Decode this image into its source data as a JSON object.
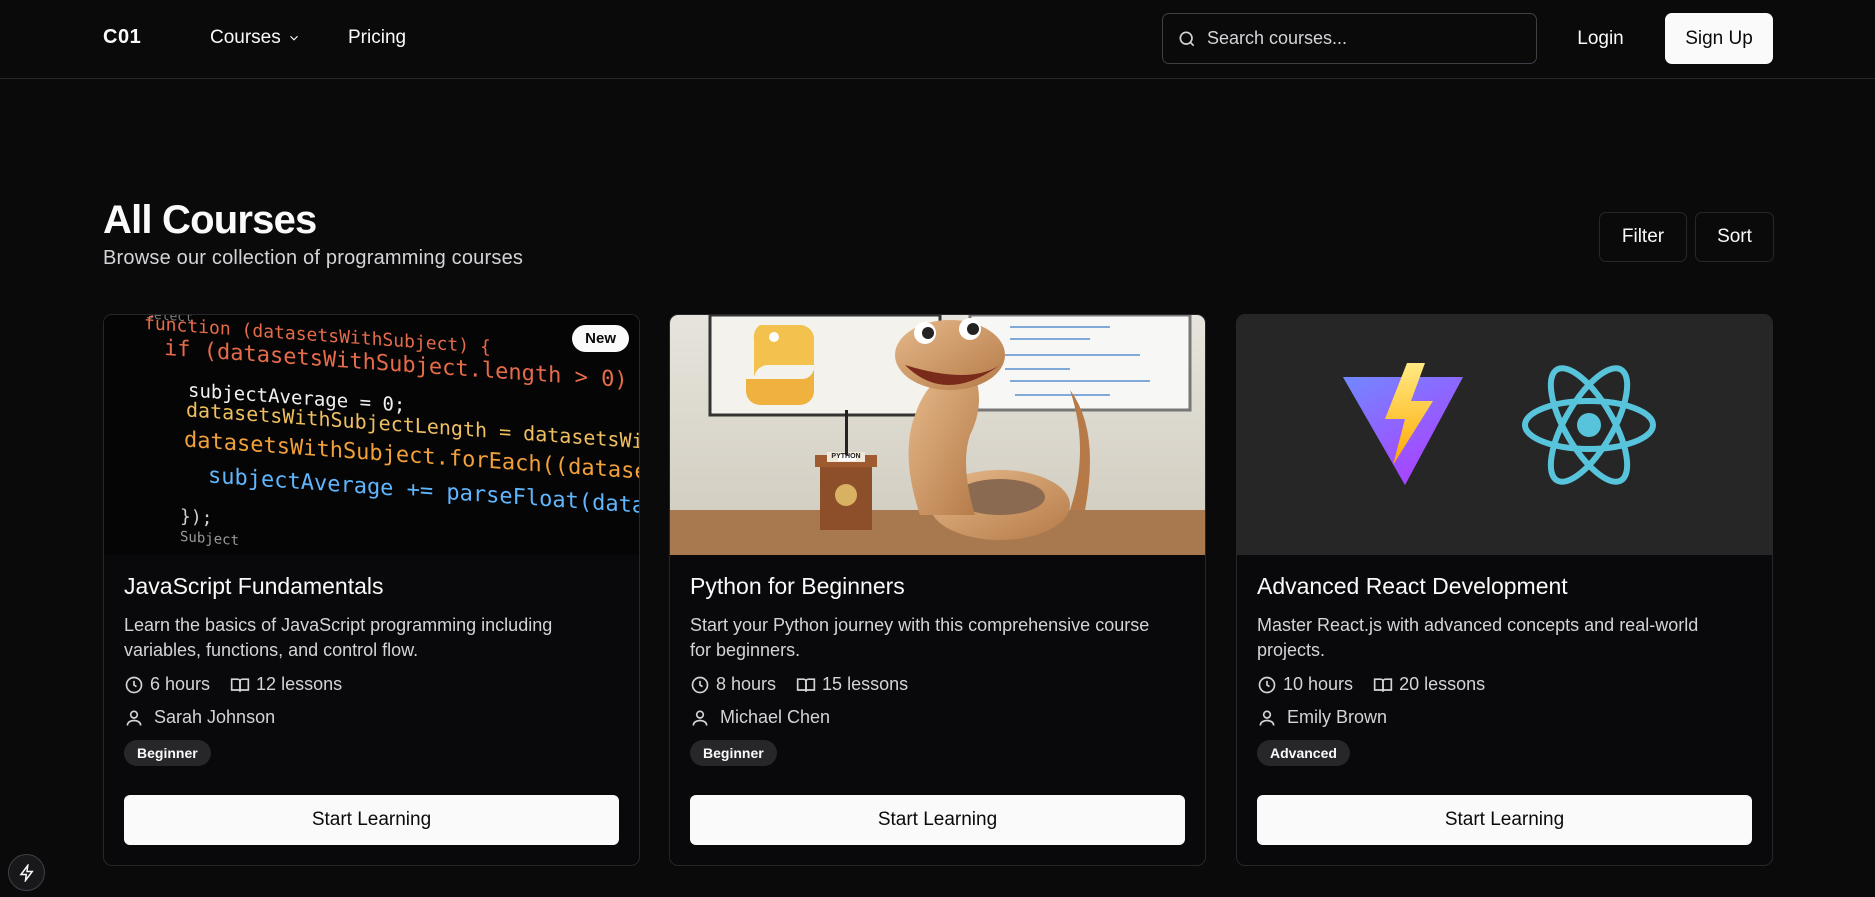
{
  "header": {
    "logo": "C01",
    "nav": [
      {
        "label": "Courses",
        "has_dropdown": true
      },
      {
        "label": "Pricing",
        "has_dropdown": false
      }
    ],
    "search_placeholder": "Search courses...",
    "login_label": "Login",
    "signup_label": "Sign Up"
  },
  "page": {
    "title": "All Courses",
    "subtitle": "Browse our collection of programming courses",
    "filter_label": "Filter",
    "sort_label": "Sort"
  },
  "courses": [
    {
      "title": "JavaScript Fundamentals",
      "description": "Learn the basics of JavaScript programming including variables, functions, and control flow.",
      "duration": "6 hours",
      "lessons": "12 lessons",
      "instructor": "Sarah Johnson",
      "level": "Beginner",
      "badge": "New",
      "cta": "Start Learning",
      "code_lines": [
        "Select",
        "function (datasetsWithSubject) {",
        "if (datasetsWithSubject.length > 0) {",
        "subjectAverage = 0;",
        "datasetsWithSubjectLength = datasetsWithSu",
        "datasetsWithSubject.forEach((dataset) => {",
        "subjectAverage += parseFloat(dataset[\"",
        "});",
        "Subject"
      ]
    },
    {
      "title": "Python for Beginners",
      "description": "Start your Python journey with this comprehensive course for beginners.",
      "duration": "8 hours",
      "lessons": "15 lessons",
      "instructor": "Michael Chen",
      "level": "Beginner",
      "cta": "Start Learning",
      "podium_label": "PYTHON"
    },
    {
      "title": "Advanced React Development",
      "description": "Master React.js with advanced concepts and real-world projects.",
      "duration": "10 hours",
      "lessons": "20 lessons",
      "instructor": "Emily Brown",
      "level": "Advanced",
      "cta": "Start Learning"
    }
  ],
  "colors": {
    "background": "#0a0a0b",
    "border": "#27272a",
    "text": "#fafafa",
    "muted": "#d4d4d8",
    "react_blue": "#58c4dc",
    "vite_purple": "#a855f7",
    "vite_yellow": "#ffd62e"
  }
}
